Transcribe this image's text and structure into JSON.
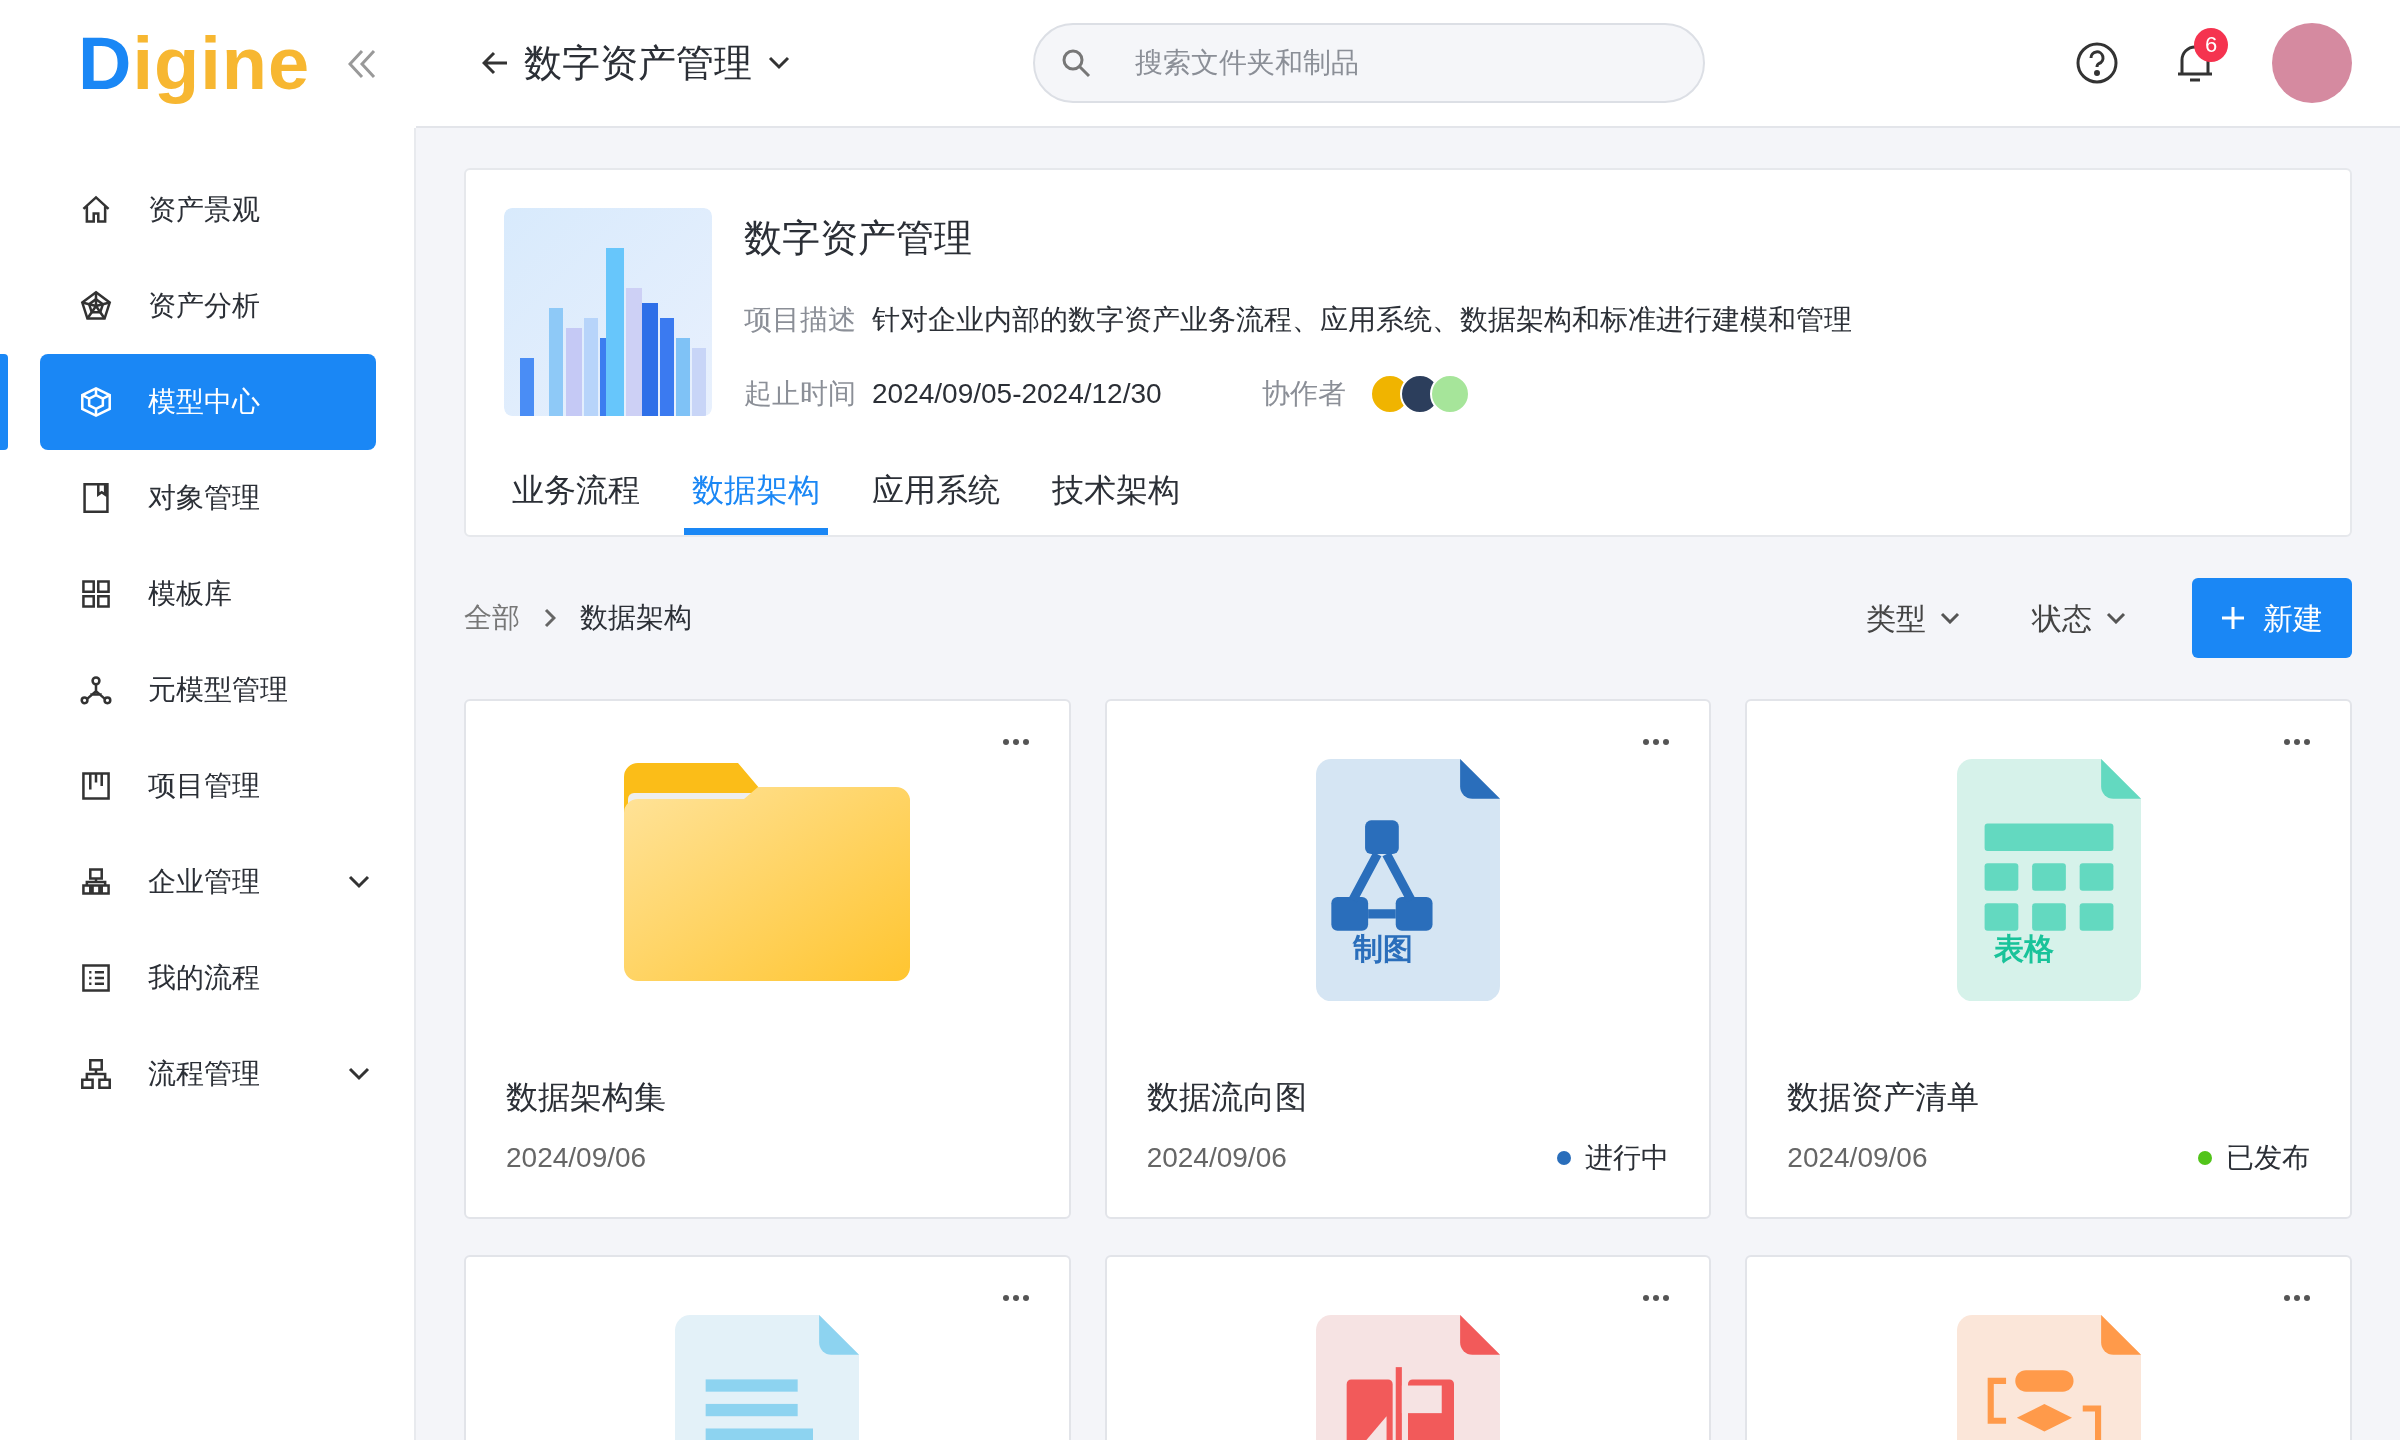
{
  "logo": {
    "text": "Digine"
  },
  "sidebar": {
    "items": [
      {
        "kind": "home",
        "label": "资产景观",
        "selected": false,
        "expandable": false
      },
      {
        "kind": "radar",
        "label": "资产分析",
        "selected": false,
        "expandable": false
      },
      {
        "kind": "cube",
        "label": "模型中心",
        "selected": true,
        "expandable": false
      },
      {
        "kind": "bookmark",
        "label": "对象管理",
        "selected": false,
        "expandable": false
      },
      {
        "kind": "grid",
        "label": "模板库",
        "selected": false,
        "expandable": false
      },
      {
        "kind": "nodes",
        "label": "元模型管理",
        "selected": false,
        "expandable": false
      },
      {
        "kind": "kanban",
        "label": "项目管理",
        "selected": false,
        "expandable": false
      },
      {
        "kind": "org",
        "label": "企业管理",
        "selected": false,
        "expandable": true
      },
      {
        "kind": "list",
        "label": "我的流程",
        "selected": false,
        "expandable": false
      },
      {
        "kind": "hierarchy",
        "label": "流程管理",
        "selected": false,
        "expandable": true
      }
    ]
  },
  "header": {
    "title": "数字资产管理",
    "search": {
      "placeholder": "搜索文件夹和制品"
    },
    "notifications": "6"
  },
  "project": {
    "title": "数字资产管理",
    "fields": [
      {
        "label": "项目描述",
        "value": "针对企业内部的数字资产业务流程、应用系统、数据架构和标准进行建模和管理"
      }
    ],
    "period": {
      "label": "起止时间",
      "value": "2024/09/05-2024/12/30"
    },
    "collaborators": {
      "label": "协作者",
      "avatars": [
        {
          "color": "#f0b400"
        },
        {
          "color": "#2c3e5c"
        },
        {
          "color": "#a6e59a"
        }
      ]
    },
    "tabs": [
      {
        "label": "业务流程",
        "selected": false
      },
      {
        "label": "数据架构",
        "selected": true
      },
      {
        "label": "应用系统",
        "selected": false
      },
      {
        "label": "技术架构",
        "selected": false
      }
    ]
  },
  "breadcrumb": [
    {
      "label": "全部"
    },
    {
      "label": "数据架构"
    }
  ],
  "filters": [
    {
      "label": "类型"
    },
    {
      "label": "状态"
    }
  ],
  "new_button": {
    "label": "新建"
  },
  "cards": [
    {
      "kind": "folder",
      "name": "数据架构集",
      "date": "2024/09/06"
    },
    {
      "kind": "diagram",
      "icon_text": "制图",
      "name": "数据流向图",
      "date": "2024/09/06",
      "status": {
        "text": "进行中",
        "color": "#2a6ebb"
      }
    },
    {
      "kind": "sheet",
      "icon_text": "表格",
      "name": "数据资产清单",
      "date": "2024/09/06",
      "status": {
        "text": "已发布",
        "color": "#52c41a"
      }
    },
    {
      "kind": "doc"
    },
    {
      "kind": "pdf"
    },
    {
      "kind": "flow"
    }
  ]
}
